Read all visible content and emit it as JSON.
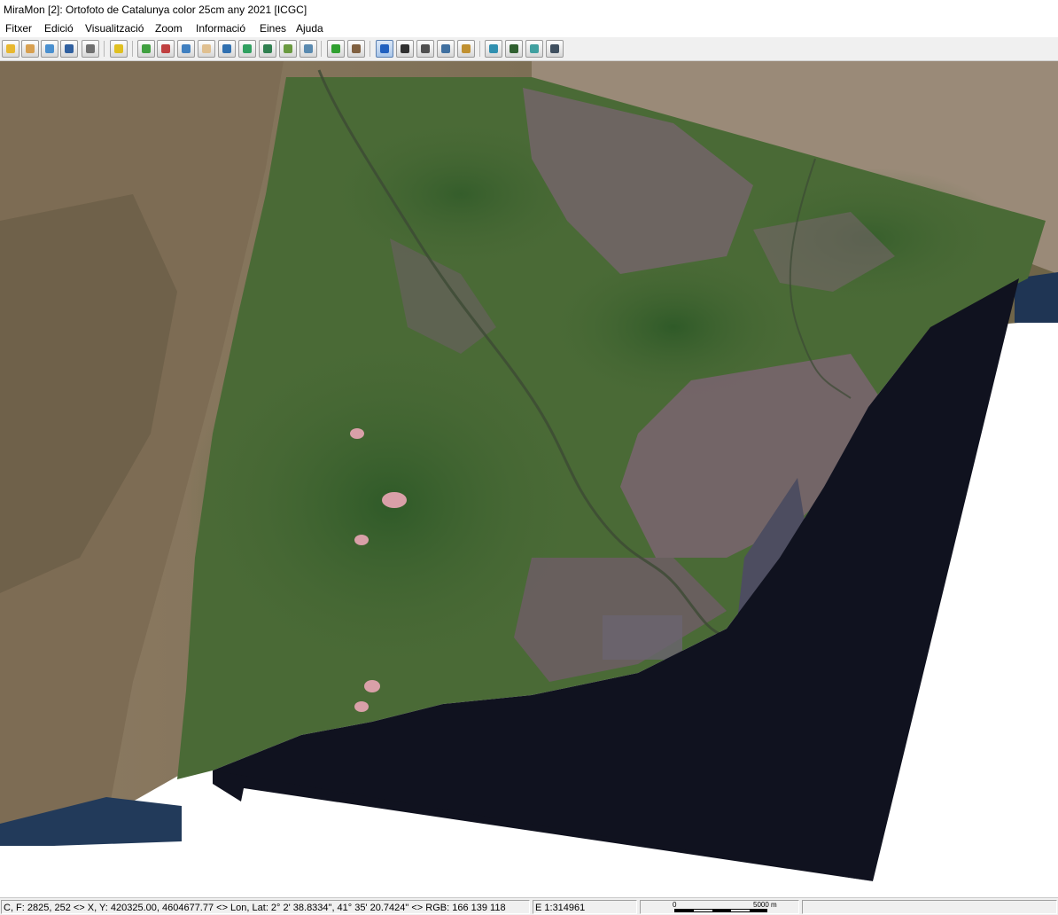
{
  "window": {
    "title": "MiraMon [2]:  Ortofoto de Catalunya color 25cm any 2021 [ICGC]"
  },
  "menu": {
    "items": [
      "Fitxer",
      "Edició",
      "Visualització",
      "Zoom",
      "Informació",
      "Eines",
      "Ajuda"
    ]
  },
  "toolbar": {
    "buttons": [
      {
        "icon": "open-folder-icon",
        "color": "#e8b830"
      },
      {
        "icon": "open-file-icon",
        "color": "#d8a050"
      },
      {
        "icon": "globe-open-icon",
        "color": "#4a90d0"
      },
      {
        "icon": "save-icon",
        "color": "#3060a0"
      },
      {
        "icon": "print-icon",
        "color": "#707070"
      },
      {
        "icon": "brightness-icon",
        "color": "#e0c020"
      },
      {
        "icon": "zoom-in-icon",
        "color": "#40a040"
      },
      {
        "icon": "zoom-out-icon",
        "color": "#c04040"
      },
      {
        "icon": "zoom-window-icon",
        "color": "#4080c0"
      },
      {
        "icon": "pan-hand-icon",
        "color": "#e0c090"
      },
      {
        "icon": "zoom-full-icon",
        "color": "#3070b0"
      },
      {
        "icon": "zoom-previous-icon",
        "color": "#30a060"
      },
      {
        "icon": "zoom-layer-icon",
        "color": "#308050"
      },
      {
        "icon": "zoom-scale-icon",
        "color": "#6a9a40"
      },
      {
        "icon": "zoom-search-icon",
        "color": "#5a8ab0"
      },
      {
        "icon": "refresh-icon",
        "color": "#30a030"
      },
      {
        "icon": "gps-icon",
        "color": "#806040"
      },
      {
        "icon": "info-icon",
        "color": "#2060c0"
      },
      {
        "icon": "pointer-icon",
        "color": "#303030"
      },
      {
        "icon": "measure-icon",
        "color": "#505050"
      },
      {
        "icon": "profile-icon",
        "color": "#4070a0"
      },
      {
        "icon": "edit-icon",
        "color": "#c09030"
      },
      {
        "icon": "layers-icon",
        "color": "#3090b0"
      },
      {
        "icon": "legend-icon",
        "color": "#306030"
      },
      {
        "icon": "filter-icon",
        "color": "#40a0a0"
      },
      {
        "icon": "table-icon",
        "color": "#405060"
      }
    ]
  },
  "map": {
    "layer_name": "Ortofoto de Catalunya color 25cm any 2021",
    "colors": {
      "sea": "#10121f",
      "land_dry": "#8c7a62",
      "land_green": "#4a6a36",
      "forest": "#2f5a28",
      "urban": "#7a6470",
      "background": "#ffffff"
    }
  },
  "status": {
    "coords": "C, F: 2825, 252 <> X, Y: 420325.00, 4604677.77 <> Lon, Lat: 2° 2' 38.8334\", 41° 35' 20.7424\" <> RGB:  166 139 118",
    "scale": "E 1:314961",
    "scalebar_start": "0",
    "scalebar_end": "5000 m"
  }
}
